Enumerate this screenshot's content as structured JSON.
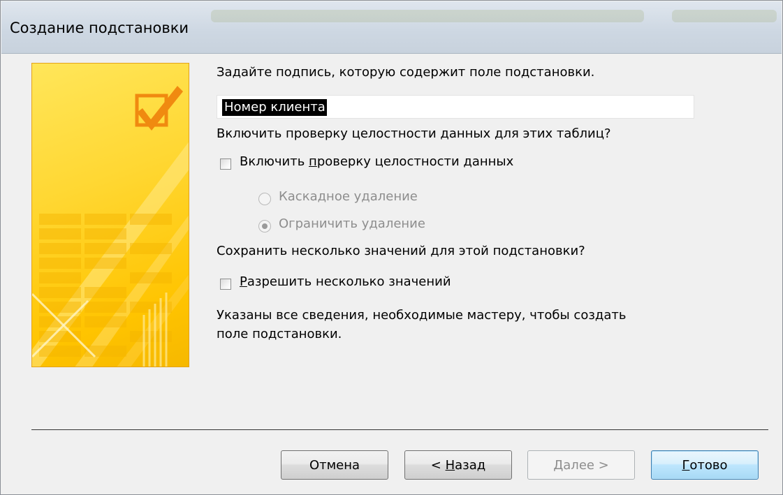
{
  "window": {
    "title": "Создание подстановки"
  },
  "step": {
    "caption_prompt": "Задайте подпись, которую содержит поле подстановки.",
    "caption_value": "Номер клиента",
    "integrity_question": "Включить проверку целостности данных для этих таблиц?",
    "integrity_checkbox": {
      "prefix": "Включить ",
      "accel": "п",
      "suffix": "роверку целостности данных",
      "checked": false
    },
    "cascade_delete_label": "Каскадное удаление",
    "restrict_delete_label": "Ограничить удаление",
    "multi_question": "Сохранить несколько значений для этой подстановки?",
    "multi_checkbox": {
      "prefix": "",
      "accel": "Р",
      "suffix": "азрешить несколько значений",
      "checked": false
    },
    "info_line1": "Указаны все сведения, необходимые мастеру, чтобы создать",
    "info_line2": "поле подстановки."
  },
  "buttons": {
    "cancel": "Отмена",
    "back_prefix": "< ",
    "back_accel": "Н",
    "back_suffix": "азад",
    "next_accel": "Д",
    "next_suffix": "алее >",
    "finish_accel": "Г",
    "finish_suffix": "отово"
  },
  "colors": {
    "art_yellow": "#ffd732",
    "art_border": "#e3a21a",
    "dialog_bg": "#f0f0f0",
    "default_button": "#3c7fb1",
    "disabled_text": "#8d8d8d"
  },
  "icons": {
    "wizard_art": "checkmark-in-box-icon"
  }
}
